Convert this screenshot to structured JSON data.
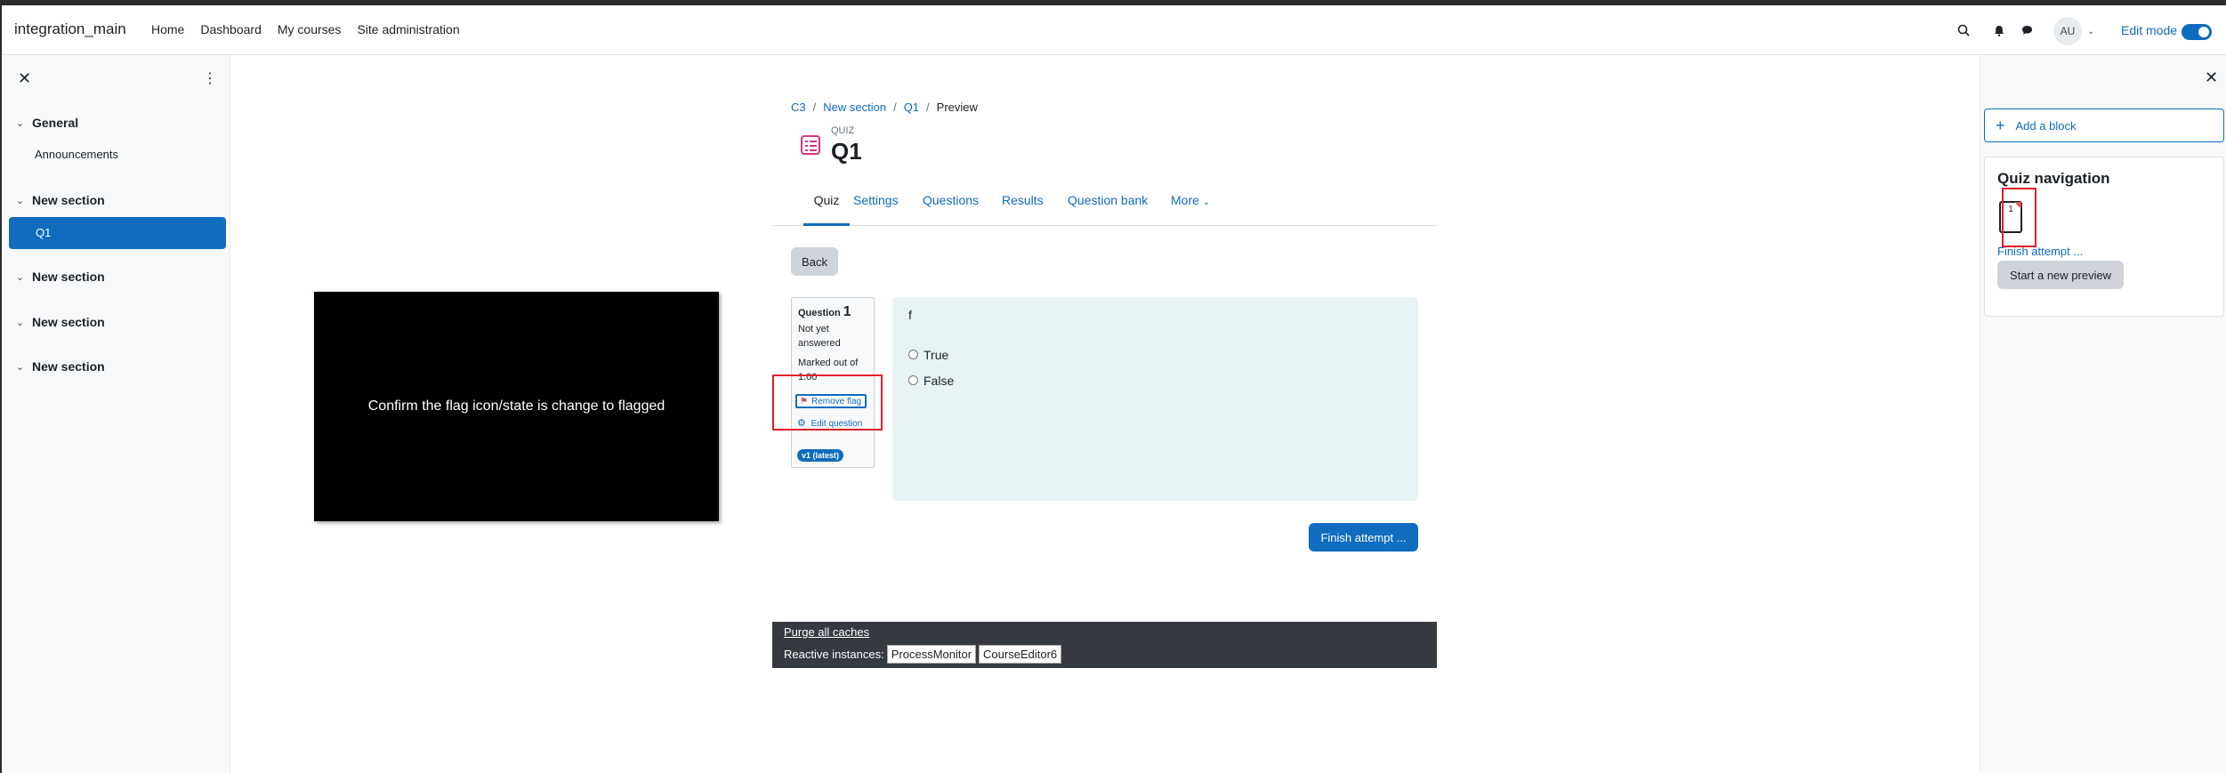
{
  "navbar": {
    "site_name": "integration_main",
    "links": [
      "Home",
      "Dashboard",
      "My courses",
      "Site administration"
    ],
    "avatar_initials": "AU",
    "edit_mode_label": "Edit mode",
    "edit_mode_on": true,
    "icons": [
      "search-icon",
      "bell-icon",
      "chat-icon",
      "chevron-down-icon"
    ]
  },
  "left_drawer": {
    "sections": [
      {
        "label": "General",
        "items": [
          "Announcements"
        ]
      },
      {
        "label": "New section",
        "items": [
          "Q1"
        ]
      },
      {
        "label": "New section",
        "items": []
      },
      {
        "label": "New section",
        "items": []
      },
      {
        "label": "New section",
        "items": []
      }
    ],
    "active_item": "Q1"
  },
  "video_overlay": {
    "caption": "Confirm the flag icon/state is change to flagged"
  },
  "breadcrumb": [
    "C3",
    "New section",
    "Q1",
    "Preview"
  ],
  "header": {
    "pretitle": "QUIZ",
    "title": "Q1"
  },
  "tabs": [
    "Quiz",
    "Settings",
    "Questions",
    "Results",
    "Question bank",
    "More"
  ],
  "active_tab": "Quiz",
  "back_label": "Back",
  "question": {
    "label": "Question",
    "number": "1",
    "state": "Not yet answered",
    "marked_out_of": "Marked out of 1.00",
    "flag_label": "Remove flag",
    "edit_label": "Edit question",
    "version_badge": "v1 (latest)",
    "text": "f",
    "answers": [
      "True",
      "False"
    ]
  },
  "finish_attempt_label": "Finish attempt ...",
  "footer": {
    "purge": "Purge all caches",
    "reactive_label": "Reactive instances:",
    "instances": [
      "ProcessMonitor",
      "CourseEditor6"
    ]
  },
  "right_drawer": {
    "add_block": "Add a block",
    "nav_title": "Quiz navigation",
    "nav_button": "1",
    "finish_link": "Finish attempt ...",
    "new_preview": "Start a new preview"
  },
  "colors": {
    "accent": "#0f6cbf",
    "flag": "#d9534f",
    "highlight_box": "#e0202a",
    "question_bg": "#e7f3f5"
  }
}
